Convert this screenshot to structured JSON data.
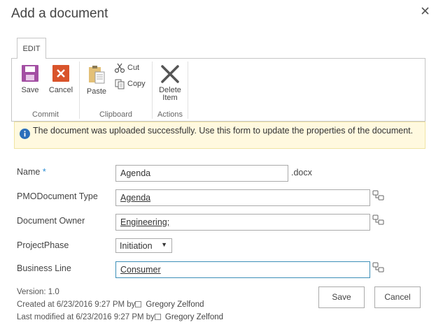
{
  "dialog": {
    "title": "Add a document",
    "close_icon": "close-icon"
  },
  "ribbon": {
    "tab_label": "EDIT",
    "groups": {
      "commit": {
        "label": "Commit",
        "save_label": "Save",
        "cancel_label": "Cancel"
      },
      "clipboard": {
        "label": "Clipboard",
        "paste_label": "Paste",
        "cut_label": "Cut",
        "copy_label": "Copy"
      },
      "actions": {
        "label": "Actions",
        "delete_label_line1": "Delete",
        "delete_label_line2": "Item"
      }
    }
  },
  "status": {
    "message": "The document was uploaded successfully. Use this form to update the properties of the document.",
    "icon": "info-icon"
  },
  "form": {
    "name": {
      "label": "Name",
      "required_marker": "*",
      "value": "Agenda",
      "suffix": ".docx"
    },
    "pmo_type": {
      "label": "PMODocument Type",
      "value": "Agenda"
    },
    "owner": {
      "label": "Document Owner",
      "value": "Engineering;"
    },
    "phase": {
      "label": "ProjectPhase",
      "value": "Initiation"
    },
    "business_line": {
      "label": "Business Line",
      "value": "Consumer"
    }
  },
  "meta": {
    "version": "Version: 1.0",
    "created": "Created at 6/23/2016 9:27 PM  by",
    "created_by": "Gregory Zelfond",
    "modified": "Last modified at 6/23/2016 9:27 PM  by",
    "modified_by": "Gregory Zelfond"
  },
  "buttons": {
    "save": "Save",
    "cancel": "Cancel"
  },
  "colors": {
    "save_icon": "#a34fa3",
    "cancel_icon": "#d9542b",
    "info_icon": "#2a6ebb",
    "status_bg": "#fff9df",
    "focus_border": "#3d8fb8"
  }
}
